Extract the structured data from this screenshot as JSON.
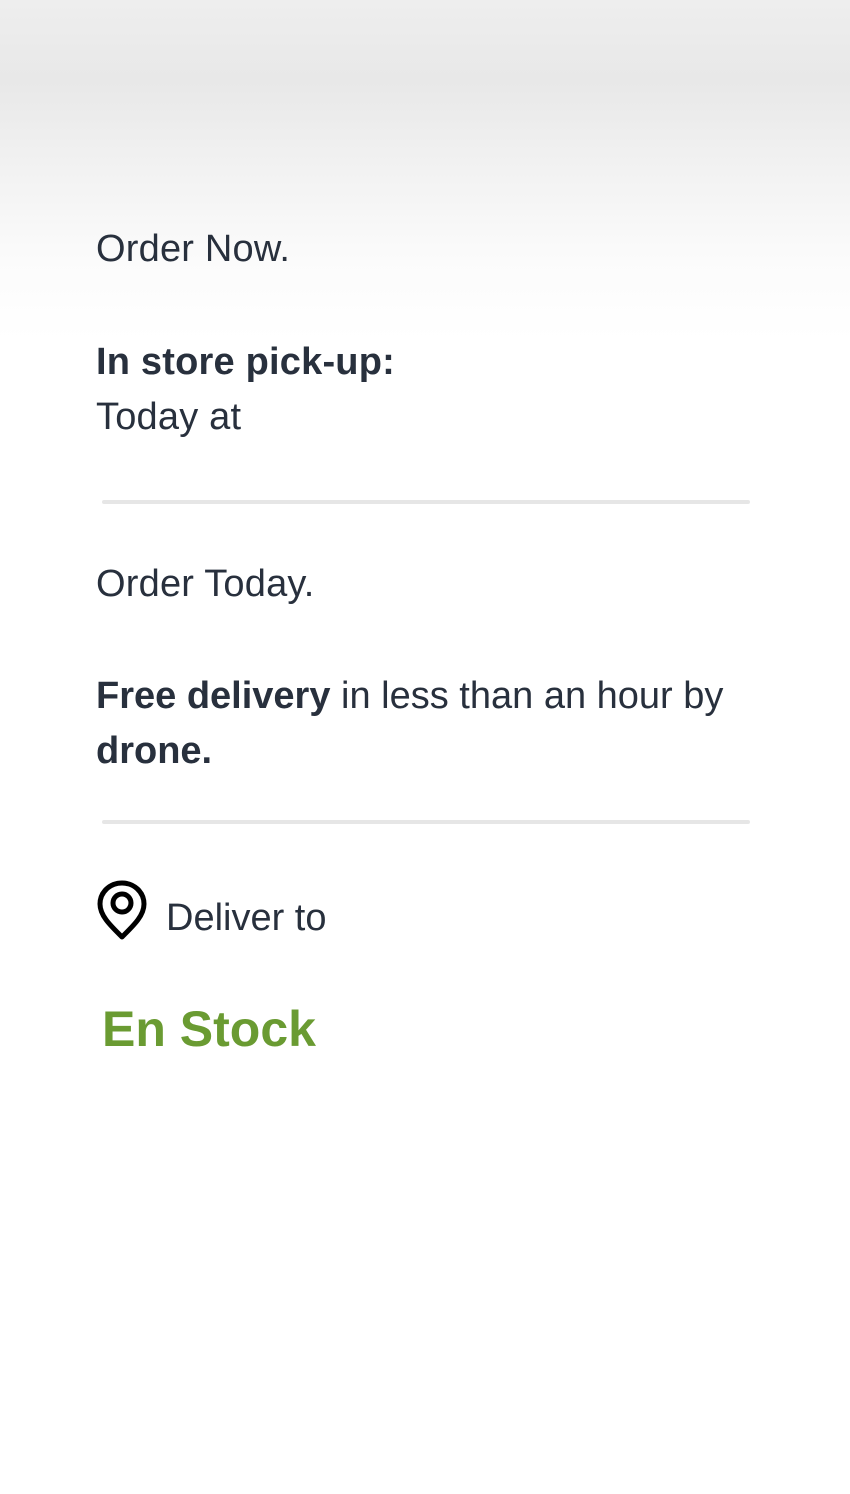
{
  "pickup": {
    "order_now": "Order Now.",
    "label": "In store pick-up:",
    "time": "Today at"
  },
  "delivery": {
    "order_today": "Order Today.",
    "free_delivery": "Free delivery",
    "middle": " in less than an hour by ",
    "drone": "drone."
  },
  "location": {
    "icon": "map-pin-icon",
    "label": "Deliver to"
  },
  "availability": {
    "status": "En Stock",
    "color": "#6a9b32"
  },
  "colors": {
    "text": "#28303d",
    "divider": "#e6e6e6"
  }
}
